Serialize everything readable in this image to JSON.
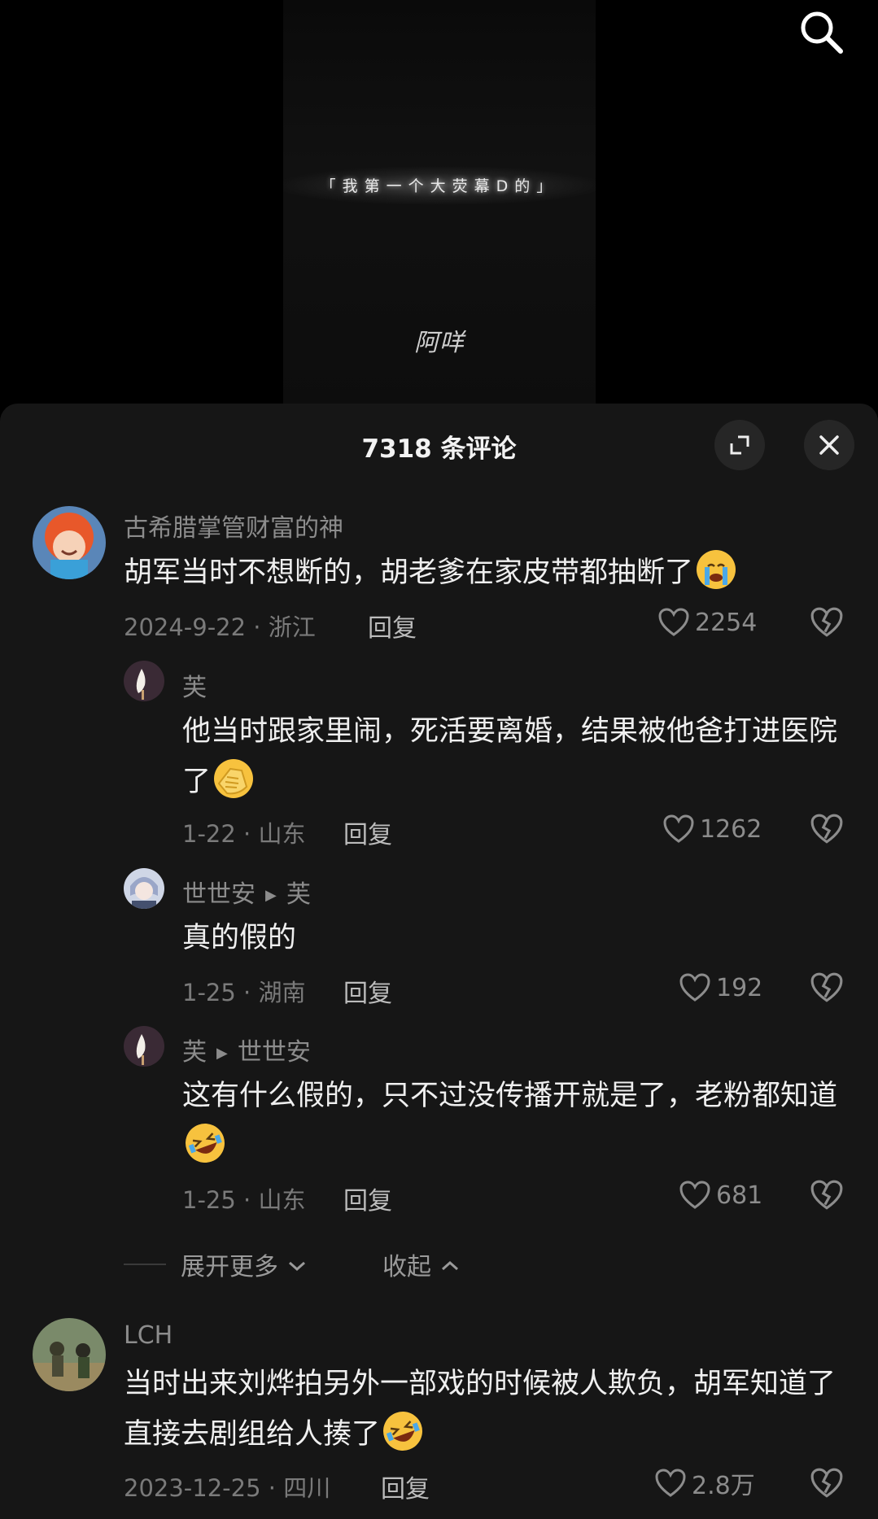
{
  "video": {
    "caption": "「我第一个大荧幕D的」",
    "signature": "阿咩"
  },
  "panel": {
    "title": "7318 条评论"
  },
  "comments": [
    {
      "user": "古希腊掌管财富的神",
      "text": "胡军当时不想断的，胡老爹在家皮带都抽断了",
      "emoji": "loudly-crying-face",
      "meta": "2024-9-22 · 浙江",
      "reply": "回复",
      "likes": "2254"
    },
    {
      "user": "芙",
      "text": "他当时跟家里闹，死活要离婚，结果被他爸打进医院了",
      "emoji": "face-palm",
      "meta": "1-22 · 山东",
      "reply": "回复",
      "likes": "1262"
    },
    {
      "user": "世世安",
      "reply_to": "芙",
      "text": "真的假的",
      "meta": "1-25 · 湖南",
      "reply": "回复",
      "likes": "192"
    },
    {
      "user": "芙",
      "reply_to": "世世安",
      "text": "这有什么假的，只不过没传播开就是了，老粉都知道",
      "emoji": "rolling-on-floor-laughing",
      "meta": "1-25 · 山东",
      "reply": "回复",
      "likes": "681"
    },
    {
      "user": "LCH",
      "text": "当时出来刘烨拍另外一部戏的时候被人欺负，胡军知道了直接去剧组给人揍了",
      "emoji": "rolling-on-floor-laughing",
      "meta": "2023-12-25 · 四川",
      "reply": "回复",
      "likes": "2.8万"
    }
  ],
  "thread": {
    "expand_more": "展开更多",
    "collapse": "收起"
  },
  "colors": {
    "panel_bg": "#161616",
    "muted_text": "#8c8c8c",
    "body_text": "#efefef"
  }
}
